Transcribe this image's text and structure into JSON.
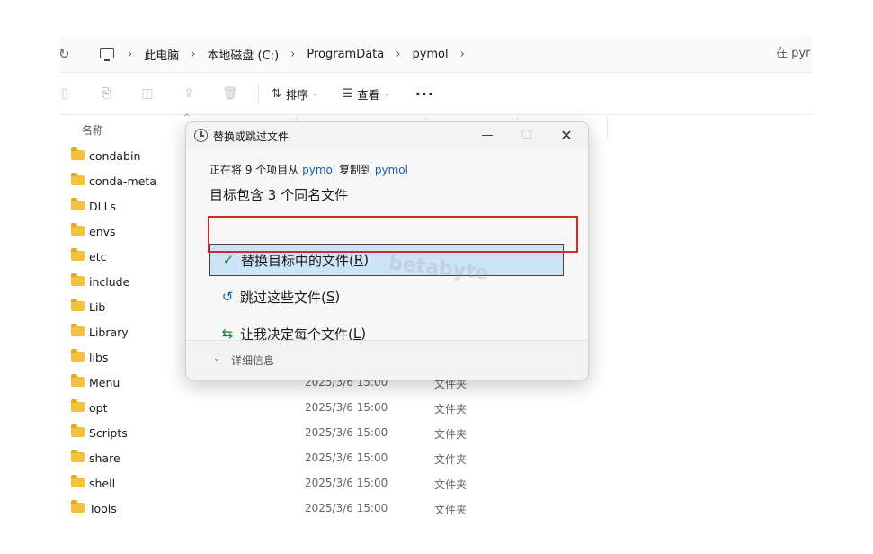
{
  "address": {
    "crumbs": [
      "此电脑",
      "本地磁盘 (C:)",
      "ProgramData",
      "pymol"
    ],
    "search_placeholder": "在 pyr"
  },
  "toolbar": {
    "sort_label": "排序",
    "view_label": "查看",
    "more_label": "···"
  },
  "list": {
    "name_header": "名称",
    "rows": [
      {
        "name": "condabin",
        "date": "",
        "type": ""
      },
      {
        "name": "conda-meta",
        "date": "",
        "type": ""
      },
      {
        "name": "DLLs",
        "date": "",
        "type": ""
      },
      {
        "name": "envs",
        "date": "",
        "type": ""
      },
      {
        "name": "etc",
        "date": "",
        "type": ""
      },
      {
        "name": "include",
        "date": "",
        "type": ""
      },
      {
        "name": "Lib",
        "date": "",
        "type": ""
      },
      {
        "name": "Library",
        "date": "",
        "type": ""
      },
      {
        "name": "libs",
        "date": "",
        "type": ""
      },
      {
        "name": "Menu",
        "date": "2025/3/6 15:00",
        "type": "文件夹"
      },
      {
        "name": "opt",
        "date": "2025/3/6 15:00",
        "type": "文件夹"
      },
      {
        "name": "Scripts",
        "date": "2025/3/6 15:00",
        "type": "文件夹"
      },
      {
        "name": "share",
        "date": "2025/3/6 15:00",
        "type": "文件夹"
      },
      {
        "name": "shell",
        "date": "2025/3/6 15:00",
        "type": "文件夹"
      },
      {
        "name": "Tools",
        "date": "2025/3/6 15:00",
        "type": "文件夹"
      }
    ]
  },
  "dialog": {
    "title": "替换或跳过文件",
    "copy_prefix": "正在将 9 个项目从",
    "copy_source": "pymol",
    "copy_mid": "复制到",
    "copy_dest": "pymol",
    "heading": "目标包含 3 个同名文件",
    "replace_label": "替换目标中的文件(",
    "replace_key": "R",
    "skip_label": "跳过这些文件(",
    "skip_key": "S",
    "decide_label": "让我决定每个文件(",
    "decide_key": "L",
    "details_label": "详细信息",
    "watermark": "betabyte"
  }
}
